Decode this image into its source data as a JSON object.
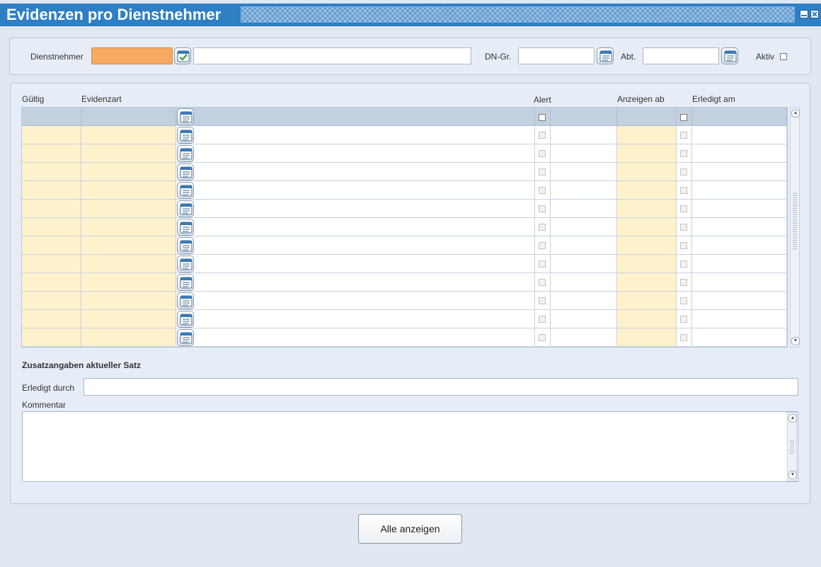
{
  "window": {
    "title": "Evidenzen pro Dienstnehmer"
  },
  "filter": {
    "dienstnehmer_label": "Dienstnehmer",
    "dn_gr_label": "DN-Gr.",
    "abt_label": "Abt.",
    "aktiv_label": "Aktiv",
    "dienstnehmer_value": "",
    "dienstnehmer_name": "",
    "dn_gr_value": "",
    "abt_value": ""
  },
  "grid": {
    "columns": [
      "Gültig",
      "Evidenzart",
      "Alert",
      "Anzeigen ab",
      "Erledigt am"
    ],
    "row_count": 12,
    "rows": []
  },
  "details": {
    "section_title": "Zusatzangaben aktueller Satz",
    "erledigt_durch_label": "Erledigt durch",
    "erledigt_durch_value": "",
    "kommentar_label": "Kommentar",
    "kommentar_value": ""
  },
  "footer": {
    "alle_anzeigen_label": "Alle anzeigen"
  },
  "colors": {
    "titlebar": "#2e7fc4",
    "required_field": "#f9aa62",
    "editable_cell": "#fef2cc",
    "grid_header": "#c3d0e0"
  }
}
